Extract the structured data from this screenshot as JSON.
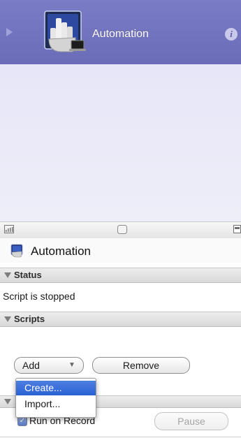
{
  "header": {
    "title": "Automation",
    "info_glyph": "i",
    "icon": "automation-app-icon"
  },
  "preview_toolbar": {
    "icons": [
      "signal-bars-icon",
      "scroller-knob-icon",
      "screen-layout-icon"
    ]
  },
  "section": {
    "title": "Automation",
    "icon": "automation-small-icon"
  },
  "groups": {
    "status_label": "Status",
    "scripts_label": "Scripts"
  },
  "status": {
    "text": "Script is stopped"
  },
  "buttons": {
    "add_label": "Add",
    "add_caret": "▼",
    "remove_label": "Remove",
    "pause_label": "Pause"
  },
  "menu": {
    "items": [
      {
        "label": "Create...",
        "selected": true
      },
      {
        "label": "Import...",
        "selected": false
      }
    ]
  },
  "checkbox": {
    "label": "Run on Record",
    "checked": true
  },
  "colors": {
    "header": "#6a6cb8",
    "preview": "#eaeaf8",
    "selection": "#2f66d6"
  }
}
